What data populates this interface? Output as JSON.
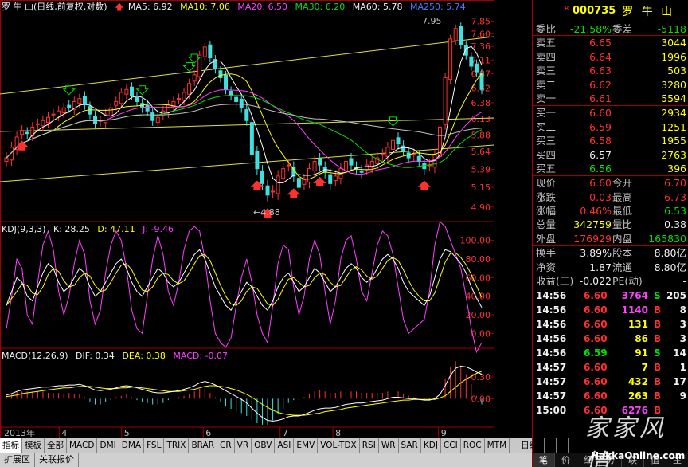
{
  "main_legend": {
    "title": "罗 牛 山(日线,前复权,对数)",
    "ma5": "MA5: 6.92",
    "ma10": "MA10: 7.06",
    "ma20": "MA20: 6.50",
    "ma30": "MA30: 6.20",
    "ma60": "MA60: 5.78",
    "ma250": "MA250: 5.74"
  },
  "kdj_legend": {
    "title": "KDJ(9,3,3)",
    "k": "K: 28.25",
    "d": "D: 47.11",
    "j": "J: -9.46"
  },
  "macd_legend": {
    "title": "MACD(12,26,9)",
    "dif": "DIF: 0.34",
    "dea": "DEA: 0.38",
    "macd": "MACD: -0.07"
  },
  "annotations": {
    "high": "7.95",
    "low": "4.88"
  },
  "price_axis": [
    "7.85",
    "7.60",
    "7.36",
    "7.11",
    "6.87",
    "6.62",
    "6.38",
    "6.13",
    "5.88",
    "5.64",
    "5.39",
    "5.15",
    "4.90"
  ],
  "kdj_axis": [
    "100.00",
    "80.00",
    "60.00",
    "40.00",
    "20.00",
    "0.00"
  ],
  "macd_axis": [
    "0.30",
    "0.00"
  ],
  "date_axis": [
    "2013年",
    "4",
    "5",
    "6",
    "7",
    "8",
    "9"
  ],
  "chart_data": {
    "type": "candlestick",
    "title": "罗 牛 山(日线,前复权,对数)",
    "ylim": [
      4.8,
      7.95
    ],
    "x": [
      "2013年",
      "4",
      "5",
      "6",
      "7",
      "8",
      "9"
    ],
    "close": [
      5.55,
      5.7,
      5.85,
      5.95,
      5.9,
      6.0,
      6.05,
      6.1,
      6.15,
      6.2,
      6.25,
      6.3,
      6.3,
      6.4,
      6.45,
      6.35,
      6.2,
      6.05,
      6.1,
      6.2,
      6.3,
      6.4,
      6.55,
      6.6,
      6.5,
      6.4,
      6.3,
      6.25,
      6.1,
      6.15,
      6.25,
      6.35,
      6.4,
      6.45,
      6.55,
      6.7,
      6.85,
      7.2,
      7.35,
      7.15,
      6.95,
      6.8,
      6.6,
      6.5,
      6.4,
      6.3,
      6.1,
      5.6,
      5.4,
      5.2,
      5.05,
      5.1,
      5.3,
      5.4,
      5.45,
      5.3,
      5.15,
      5.25,
      5.4,
      5.5,
      5.45,
      5.35,
      5.2,
      5.3,
      5.4,
      5.5,
      5.45,
      5.4,
      5.35,
      5.45,
      5.5,
      5.55,
      5.6,
      5.7,
      5.8,
      5.75,
      5.65,
      5.55,
      5.6,
      5.5,
      5.4,
      5.45,
      5.6,
      6.0,
      6.8,
      7.5,
      7.7,
      7.4,
      7.2,
      7.0,
      6.9,
      6.6
    ],
    "ma_lines": [
      "MA5",
      "MA10",
      "MA20",
      "MA30",
      "MA60"
    ],
    "kdj_k": [
      30,
      45,
      60,
      55,
      40,
      35,
      50,
      65,
      75,
      70,
      55,
      45,
      50,
      60,
      70,
      65,
      50,
      40,
      45,
      55,
      65,
      75,
      80,
      70,
      55,
      45,
      40,
      50,
      60,
      70,
      65,
      55,
      50,
      55,
      65,
      75,
      85,
      90,
      80,
      65,
      50,
      40,
      30,
      25,
      35,
      45,
      55,
      50,
      40,
      30,
      25,
      35,
      50,
      60,
      65,
      55,
      45,
      50,
      60,
      70,
      65,
      55,
      45,
      50,
      60,
      70,
      75,
      70,
      60,
      55,
      60,
      70,
      80,
      85,
      80,
      70,
      55,
      45,
      40,
      35,
      30,
      40,
      60,
      80,
      90,
      88,
      82,
      75,
      65,
      50,
      38,
      28
    ],
    "kdj_j": [
      5,
      40,
      80,
      70,
      20,
      10,
      55,
      95,
      110,
      90,
      45,
      20,
      40,
      75,
      100,
      85,
      35,
      10,
      25,
      65,
      95,
      110,
      100,
      70,
      25,
      5,
      0,
      40,
      80,
      105,
      85,
      45,
      30,
      55,
      90,
      110,
      115,
      110,
      80,
      35,
      0,
      -10,
      -15,
      -5,
      30,
      60,
      80,
      55,
      20,
      0,
      -10,
      30,
      75,
      95,
      90,
      50,
      20,
      40,
      80,
      100,
      85,
      45,
      10,
      35,
      80,
      100,
      105,
      80,
      45,
      35,
      65,
      95,
      110,
      105,
      85,
      50,
      15,
      0,
      5,
      10,
      15,
      45,
      95,
      120,
      115,
      100,
      85,
      70,
      40,
      5,
      -20,
      -10
    ],
    "macd_dif": [
      0.05,
      0.07,
      0.1,
      0.12,
      0.13,
      0.14,
      0.15,
      0.16,
      0.16,
      0.17,
      0.18,
      0.18,
      0.19,
      0.19,
      0.2,
      0.18,
      0.15,
      0.12,
      0.11,
      0.12,
      0.13,
      0.15,
      0.17,
      0.18,
      0.17,
      0.15,
      0.13,
      0.11,
      0.09,
      0.08,
      0.08,
      0.09,
      0.1,
      0.11,
      0.13,
      0.15,
      0.18,
      0.22,
      0.24,
      0.22,
      0.19,
      0.15,
      0.11,
      0.07,
      0.03,
      -0.01,
      -0.06,
      -0.13,
      -0.2,
      -0.26,
      -0.3,
      -0.31,
      -0.3,
      -0.28,
      -0.25,
      -0.24,
      -0.24,
      -0.22,
      -0.19,
      -0.16,
      -0.14,
      -0.13,
      -0.13,
      -0.12,
      -0.1,
      -0.08,
      -0.07,
      -0.06,
      -0.06,
      -0.05,
      -0.04,
      -0.03,
      -0.02,
      0.0,
      0.02,
      0.02,
      0.01,
      0.0,
      0.0,
      -0.01,
      -0.02,
      -0.02,
      0.0,
      0.06,
      0.18,
      0.32,
      0.42,
      0.45,
      0.44,
      0.41,
      0.37,
      0.34
    ],
    "macd_dea": [
      0.03,
      0.04,
      0.05,
      0.07,
      0.08,
      0.09,
      0.1,
      0.11,
      0.12,
      0.13,
      0.14,
      0.15,
      0.15,
      0.16,
      0.17,
      0.17,
      0.17,
      0.16,
      0.15,
      0.14,
      0.14,
      0.14,
      0.15,
      0.15,
      0.16,
      0.16,
      0.15,
      0.14,
      0.13,
      0.12,
      0.11,
      0.1,
      0.1,
      0.1,
      0.11,
      0.12,
      0.13,
      0.15,
      0.17,
      0.18,
      0.18,
      0.17,
      0.16,
      0.14,
      0.12,
      0.09,
      0.06,
      0.02,
      -0.03,
      -0.08,
      -0.12,
      -0.16,
      -0.19,
      -0.21,
      -0.22,
      -0.23,
      -0.23,
      -0.23,
      -0.22,
      -0.21,
      -0.2,
      -0.18,
      -0.17,
      -0.16,
      -0.15,
      -0.13,
      -0.12,
      -0.11,
      -0.1,
      -0.09,
      -0.08,
      -0.07,
      -0.06,
      -0.05,
      -0.04,
      -0.03,
      -0.02,
      -0.02,
      -0.01,
      -0.01,
      -0.01,
      -0.01,
      -0.01,
      0.01,
      0.04,
      0.1,
      0.16,
      0.22,
      0.27,
      0.31,
      0.35,
      0.38
    ]
  },
  "quote": {
    "r_mark": "R",
    "code": "000735",
    "name": "罗 牛 山",
    "wb_label": "委比",
    "wb_value": "-21.58%",
    "wc_label": "委差",
    "wc_value": "-5118",
    "sell": [
      {
        "label": "卖五",
        "price": "6.65",
        "vol": "3044"
      },
      {
        "label": "卖四",
        "price": "6.64",
        "vol": "1996"
      },
      {
        "label": "卖三",
        "price": "6.63",
        "vol": "503"
      },
      {
        "label": "卖二",
        "price": "6.62",
        "vol": "3280"
      },
      {
        "label": "卖一",
        "price": "6.61",
        "vol": "5594"
      }
    ],
    "buy": [
      {
        "label": "买一",
        "price": "6.60",
        "vol": "2934"
      },
      {
        "label": "买二",
        "price": "6.59",
        "vol": "1251"
      },
      {
        "label": "买三",
        "price": "6.58",
        "vol": "1955"
      },
      {
        "label": "买四",
        "price": "6.57",
        "vol": "2763"
      },
      {
        "label": "买五",
        "price": "6.56",
        "vol": "396"
      }
    ],
    "stats": [
      {
        "l1": "现价",
        "v1": "6.60",
        "l2": "今开",
        "v2": "6.70"
      },
      {
        "l1": "涨跌",
        "v1": "0.03",
        "l2": "最高",
        "v2": "6.73"
      },
      {
        "l1": "涨幅",
        "v1": "0.46%",
        "l2": "最低",
        "v2": "6.53"
      },
      {
        "l1": "总量",
        "v1": "342759",
        "l2": "量比",
        "v2": "0.38"
      },
      {
        "l1": "外盘",
        "v1": "176929",
        "l2": "内盘",
        "v2": "165830"
      }
    ],
    "fin": [
      {
        "l1": "换手",
        "v1": "3.89%",
        "l2": "股本",
        "v2": "8.80亿"
      },
      {
        "l1": "净资",
        "v1": "1.87",
        "l2": "流通",
        "v2": "8.80亿"
      },
      {
        "l1": "收益(三)",
        "v1": "-0.022",
        "l2": "PE(动)",
        "v2": "-"
      }
    ],
    "ticks": [
      {
        "time": "14:56",
        "price": "6.60",
        "vol": "3764",
        "bs": "S",
        "n": "205"
      },
      {
        "time": "14:56",
        "price": "6.60",
        "vol": "1140",
        "bs": "B",
        "n": "8"
      },
      {
        "time": "14:56",
        "price": "6.60",
        "vol": "131",
        "bs": "B",
        "n": "3"
      },
      {
        "time": "14:56",
        "price": "6.60",
        "vol": "86",
        "bs": "B",
        "n": "3"
      },
      {
        "time": "14:56",
        "price": "6.59",
        "vol": "91",
        "bs": "S",
        "n": "14"
      },
      {
        "time": "14:57",
        "price": "6.60",
        "vol": "7",
        "bs": "B",
        "n": "1"
      },
      {
        "time": "14:57",
        "price": "6.60",
        "vol": "432",
        "bs": "B",
        "n": "17"
      },
      {
        "time": "14:57",
        "price": "6.60",
        "vol": "263",
        "bs": "B",
        "n": "9"
      },
      {
        "time": "15:00",
        "price": "6.60",
        "vol": "6276",
        "bs": "B",
        "n": ""
      }
    ],
    "tabs": [
      "笔",
      "价",
      "细",
      "势",
      "联",
      "值",
      "主"
    ]
  },
  "toolbar": {
    "tabs": [
      "指标",
      "模板",
      "全部",
      "MACD",
      "DMI",
      "DMA",
      "FSL",
      "TRIX",
      "BRAR",
      "CR",
      "VR",
      "OBV",
      "ASI",
      "EMV",
      "VOL-TDX",
      "RSI",
      "WR",
      "SAR",
      "KDJ",
      "CCI",
      "ROC",
      "MTM"
    ],
    "period": "日线",
    "tabs2": [
      "扩展区",
      "关联报价"
    ]
  },
  "watermark": {
    "main": "家家风情",
    "url": "HakkaOnline.com"
  }
}
